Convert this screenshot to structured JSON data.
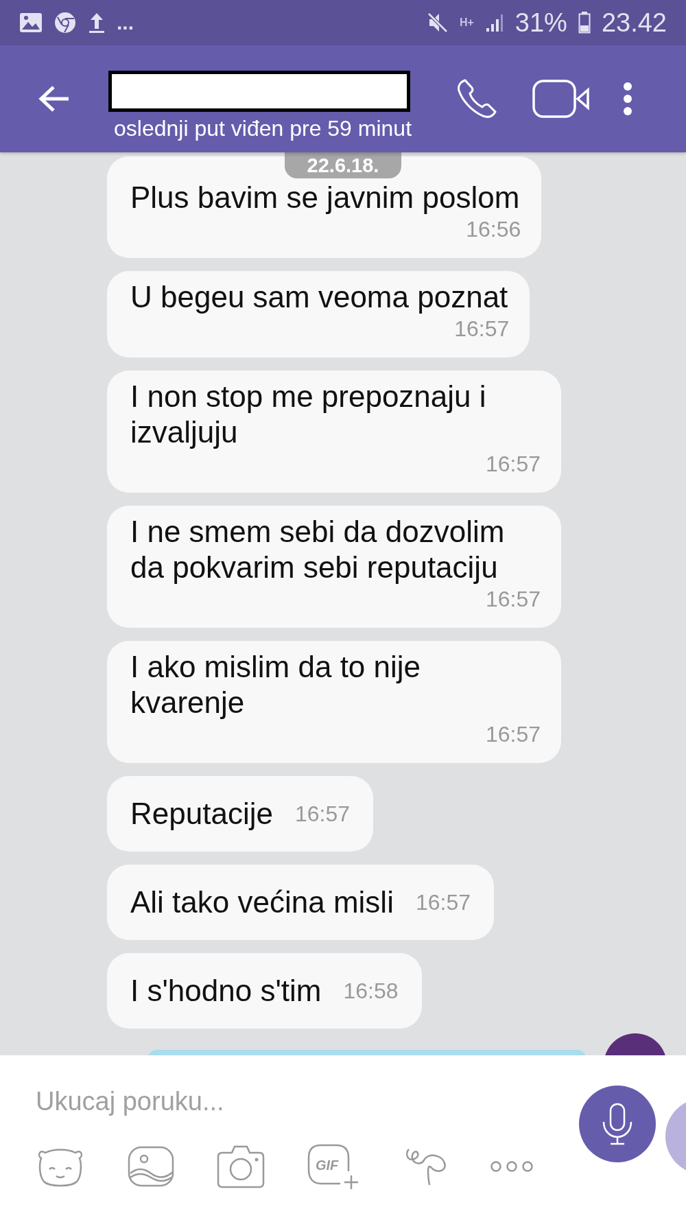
{
  "status_bar": {
    "more": "...",
    "network": "H+",
    "battery": "31%",
    "time": "23.42"
  },
  "header": {
    "subtitle": "oslednji put viđen pre 59 minut"
  },
  "date_badge": "22.6.18.",
  "messages": [
    {
      "text": "Plus bavim se javnim poslom",
      "time": "16:56",
      "kind": "stacked"
    },
    {
      "text": "U begeu sam veoma poznat",
      "time": "16:57",
      "kind": "stacked"
    },
    {
      "text": "I non stop me prepoznaju i izvaljuju",
      "time": "16:57",
      "kind": "stacked"
    },
    {
      "text": "I ne smem sebi da dozvolim da pokvarim sebi reputaciju",
      "time": "16:57",
      "kind": "stacked"
    },
    {
      "text": "I ako mislim da to nije kvarenje",
      "time": "16:57",
      "kind": "stacked"
    },
    {
      "text": "Reputacije",
      "time": "16:57",
      "kind": "inline"
    },
    {
      "text": "Ali tako većina misli",
      "time": "16:57",
      "kind": "inline"
    },
    {
      "text": "I s'hodno s'tim",
      "time": "16:58",
      "kind": "inline"
    }
  ],
  "composer": {
    "placeholder": "Ukucaj poruku...",
    "gif_label": "GIF"
  }
}
